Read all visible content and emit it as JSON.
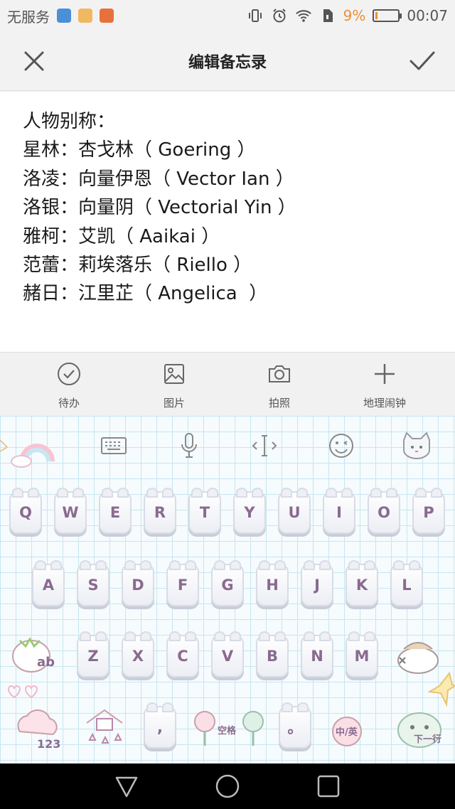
{
  "status_bar": {
    "carrier": "无服务",
    "battery_percent": "9%",
    "battery_level": 0.09,
    "time": "00:07",
    "icons": [
      "vibrate-icon",
      "alarm-icon",
      "wifi-icon",
      "sim-icon"
    ]
  },
  "title_bar": {
    "title": "编辑备忘录",
    "close_icon": "close-icon",
    "done_icon": "checkmark-icon"
  },
  "note": {
    "lines": [
      "人物别称：",
      "星林：杏戈林（ Goering ）",
      "洛凌：向量伊恩（ Vector Ian ）",
      "洛银：向量阴（ Vectorial Yin ）",
      "雅柯：艾凯（ Aaikai ）",
      "范蕾：莉埃落乐（ Riello ）",
      "赭日：江里芷（ Angelica  ）"
    ]
  },
  "note_toolbar": {
    "items": [
      {
        "label": "待办",
        "icon": "checklist-icon"
      },
      {
        "label": "图片",
        "icon": "image-icon"
      },
      {
        "label": "拍照",
        "icon": "camera-icon"
      },
      {
        "label": "地理闹钟",
        "icon": "add-icon"
      }
    ]
  },
  "keyboard": {
    "toolbar_icons": [
      "keyboard-icon",
      "microphone-icon",
      "cursor-icon",
      "emoji-icon",
      "cat-icon"
    ],
    "row1": [
      "Q",
      "W",
      "E",
      "R",
      "T",
      "Y",
      "U",
      "I",
      "O",
      "P"
    ],
    "row2": [
      "A",
      "S",
      "D",
      "F",
      "G",
      "H",
      "J",
      "K",
      "L"
    ],
    "row3": [
      "Z",
      "X",
      "C",
      "V",
      "B",
      "N",
      "M"
    ],
    "row4": [
      ",",
      "。"
    ],
    "decorations": {
      "switch_label": "ab",
      "number_label": "123",
      "space_label": "空格",
      "lang_label": "中/英",
      "enter_label": "下一行"
    }
  },
  "nav_bar": {
    "icons": [
      "back-icon",
      "home-icon",
      "recents-icon"
    ]
  }
}
